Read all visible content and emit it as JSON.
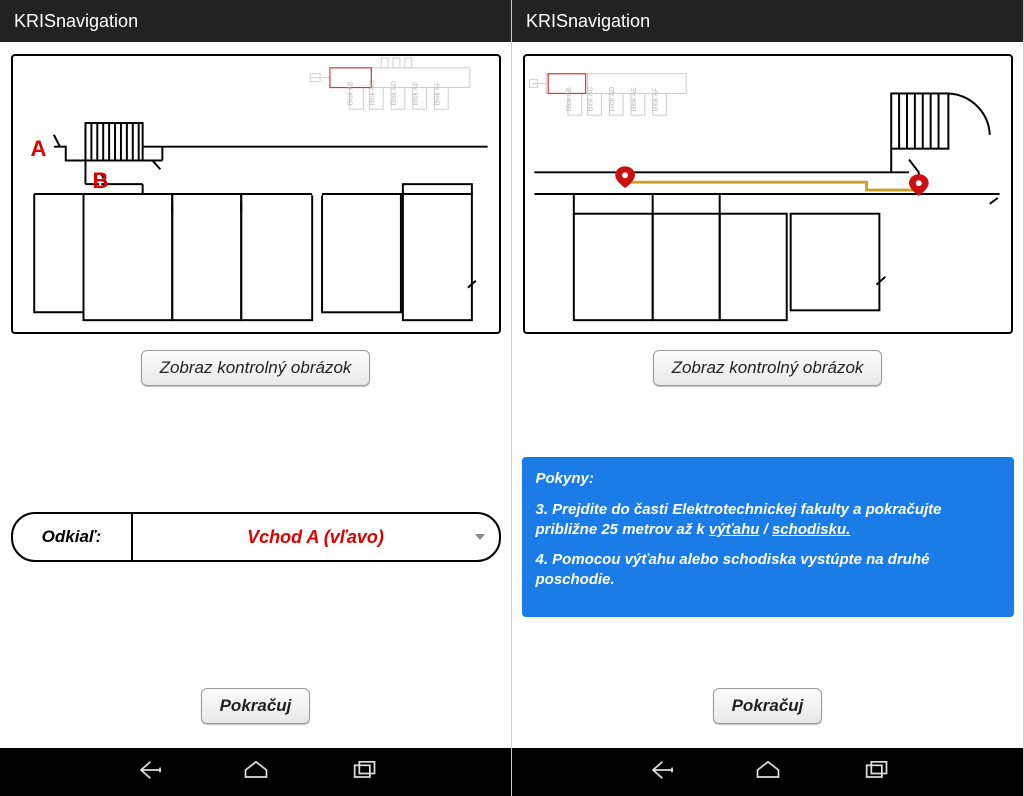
{
  "app": {
    "title": "KRISnavigation"
  },
  "left": {
    "controlBtn": "Zobraz kontrolný obrázok",
    "selector": {
      "label": "Odkiaľ:",
      "value": "Vchod A (vľavo)"
    },
    "continue": "Pokračuj",
    "markers": {
      "A": "A",
      "B": "B"
    },
    "miniBlocks": [
      "Blok AB",
      "Blok AC",
      "Blok AD",
      "Blok AE",
      "Blok AF"
    ]
  },
  "right": {
    "controlBtn": "Zobraz kontrolný obrázok",
    "continue": "Pokračuj",
    "instructionsTitle": "Pokyny:",
    "step3a": "3. Prejdite do časti Elektrotechnickej fakulty a pokračujte približne 25 metrov až k ",
    "step3_link1": "výťahu",
    "step3_sep": " / ",
    "step3_link2": "schodisku.",
    "step4": "4. Pomocou výťahu alebo schodiska vystúpte na druhé poschodie.",
    "miniBlocks": [
      "Blok AB",
      "Blok AC",
      "Blok AD",
      "Blok AE",
      "Blok AF"
    ]
  }
}
